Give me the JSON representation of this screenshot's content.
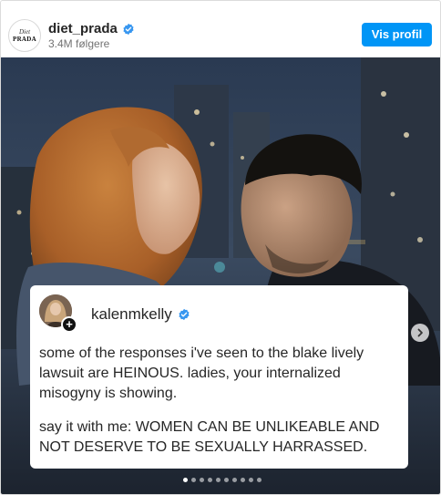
{
  "header": {
    "avatar_text_top": "Diet",
    "avatar_text_bottom": "PRADA",
    "username": "diet_prada",
    "followers": "3.4M følgere",
    "profile_button": "Vis profil"
  },
  "post": {
    "card": {
      "username": "kalenmkelly",
      "paragraph_1": "some of the responses i've seen to the blake lively lawsuit are HEINOUS. ladies, your internalized misogyny is showing.",
      "paragraph_2": "say it with me: WOMEN CAN BE UNLIKEABLE AND NOT DESERVE TO BE SEXUALLY HARRASSED."
    },
    "carousel": {
      "total_slides": 10,
      "active_slide": 1
    }
  },
  "colors": {
    "accent": "#0095f6",
    "verified": "#3897f0",
    "text": "#262626",
    "muted": "#737373"
  },
  "icons": {
    "verified": "verified-badge-icon",
    "next": "chevron-right-icon",
    "follow": "plus-icon"
  }
}
